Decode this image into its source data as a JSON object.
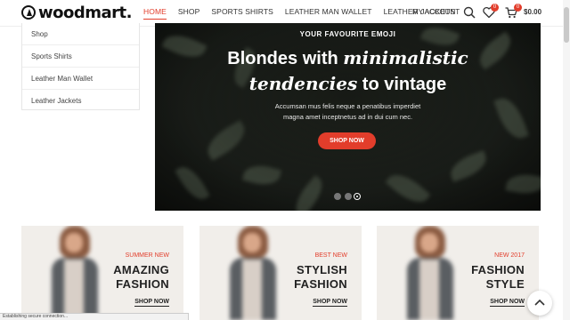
{
  "brand": {
    "name": "woodmart."
  },
  "nav": {
    "items": [
      "HOME",
      "SHOP",
      "SPORTS SHIRTS",
      "LEATHER MAN WALLET",
      "LEATHER JACKETS"
    ],
    "active_index": 0,
    "account_label": "MY ACCOUNT"
  },
  "header": {
    "wishlist_count": "0",
    "cart_count": "0",
    "cart_total": "$0.00",
    "icons": [
      "search-icon",
      "heart-icon",
      "cart-icon"
    ]
  },
  "sidebar": {
    "items": [
      "Shop",
      "Sports Shirts",
      "Leather Man Wallet",
      "Leather Jackets"
    ]
  },
  "hero": {
    "eyebrow": "YOUR FAVOURITE EMOJI",
    "line1_plain": "Blondes with ",
    "line1_em": "minimalistic",
    "line2_em": "tendencies",
    "line2_plain": " to vintage",
    "sub1": "Accumsan mus felis neque a penatibus imperdiet",
    "sub2": "magna amet inceptnetus ad in dui cum nec.",
    "button": "SHOP NOW",
    "slides": 3,
    "active_slide": 3
  },
  "banners": [
    {
      "tag": "SUMMER NEW",
      "title1": "AMAZING",
      "title2": "FASHION",
      "cta": "SHOP NOW"
    },
    {
      "tag": "BEST NEW",
      "title1": "STYLISH",
      "title2": "FASHION",
      "cta": "SHOP NOW"
    },
    {
      "tag": "NEW 2017",
      "title1": "FASHION",
      "title2": "STYLE",
      "cta": "SHOP NOW"
    }
  ],
  "status_bar": {
    "text": "Establishing secure connection..."
  },
  "colors": {
    "accent": "#e23d2b",
    "hero_bg": "#1d211c",
    "banner_bg": "#f1eeea"
  }
}
